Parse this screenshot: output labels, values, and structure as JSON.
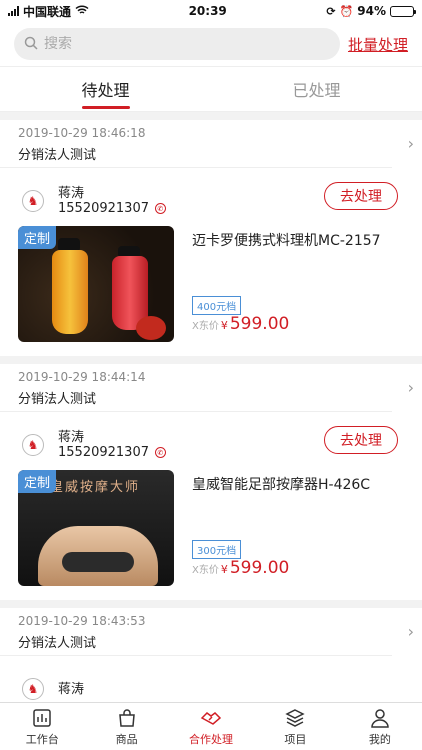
{
  "status": {
    "carrier": "中国联通",
    "time": "20:39",
    "battery": "94%",
    "battery_level": 0.94
  },
  "search": {
    "placeholder": "搜索"
  },
  "header": {
    "batch_label": "批量处理"
  },
  "tabs": [
    {
      "label": "待处理",
      "active": true
    },
    {
      "label": "已处理",
      "active": false
    }
  ],
  "orders": [
    {
      "date": "2019-10-29 18:46:18",
      "seller": "分销法人测试",
      "user_name": "蒋涛",
      "user_phone": "15520921307",
      "action_label": "去处理",
      "badge": "定制",
      "product_name": "迈卡罗便携式料理机MC-2157",
      "tier": "400元档",
      "price_label": "X东价",
      "currency": "¥",
      "price": "599.00",
      "image": "blender"
    },
    {
      "date": "2019-10-29 18:44:14",
      "seller": "分销法人测试",
      "user_name": "蒋涛",
      "user_phone": "15520921307",
      "action_label": "去处理",
      "badge": "定制",
      "product_name": "皇威智能足部按摩器H-426C",
      "tier": "300元档",
      "price_label": "X东价",
      "currency": "¥",
      "price": "599.00",
      "image": "massager",
      "image_text": "皇威按摩大师"
    },
    {
      "date": "2019-10-29 18:43:53",
      "seller": "分销法人测试",
      "user_name": "蒋涛"
    }
  ],
  "nav": [
    {
      "label": "工作台",
      "icon": "dashboard-icon",
      "active": false
    },
    {
      "label": "商品",
      "icon": "bag-icon",
      "active": false
    },
    {
      "label": "合作处理",
      "icon": "handshake-icon",
      "active": true
    },
    {
      "label": "项目",
      "icon": "layers-icon",
      "active": false
    },
    {
      "label": "我的",
      "icon": "user-icon",
      "active": false
    }
  ],
  "colors": {
    "accent": "#d11e25",
    "badge": "#4a8fd6"
  }
}
